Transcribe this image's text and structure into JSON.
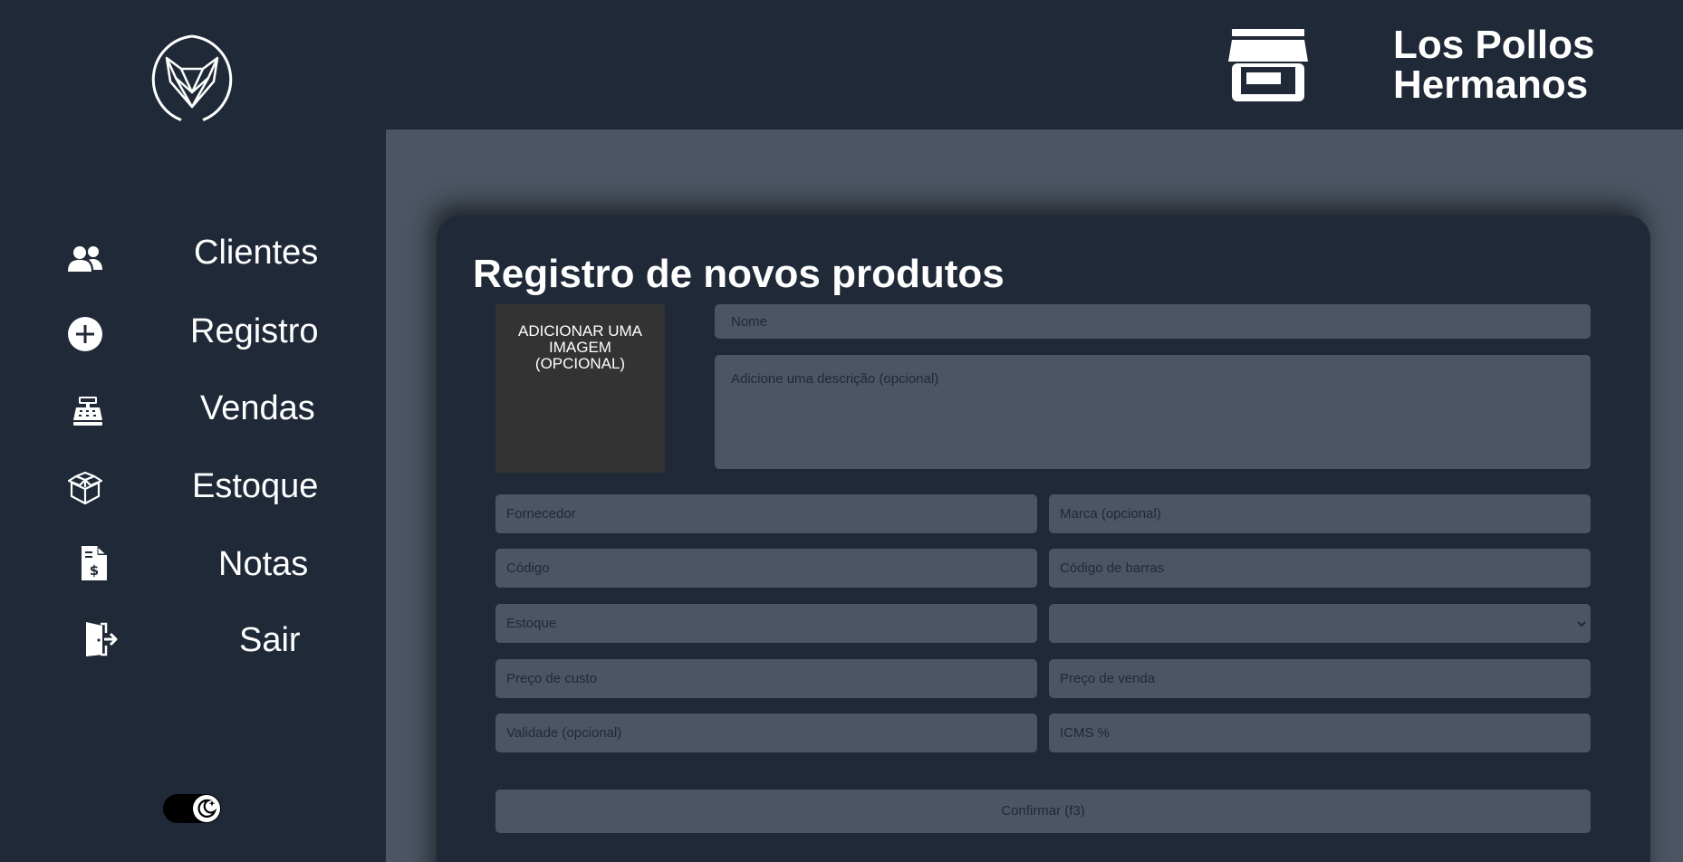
{
  "app": {
    "brand_name": "Los Pollos Hermanos"
  },
  "sidebar": {
    "logo_icon": "fox-logo-icon",
    "items": [
      {
        "label": "Clientes",
        "icon": "users-icon"
      },
      {
        "label": "Registro",
        "icon": "plus-circle-icon"
      },
      {
        "label": "Vendas",
        "icon": "cash-register-icon"
      },
      {
        "label": "Estoque",
        "icon": "boxes-icon"
      },
      {
        "label": "Notas",
        "icon": "invoice-dollar-icon"
      },
      {
        "label": "Sair",
        "icon": "door-exit-icon"
      }
    ],
    "theme_toggle_icon": "moon-icon"
  },
  "header": {
    "store_icon": "store-icon"
  },
  "form": {
    "title": "Registro de novos produtos",
    "image_upload_label": "ADICIONAR UMA IMAGEM (OPCIONAL)",
    "name_placeholder": "Nome",
    "description_placeholder": "Adicione uma descrição (opcional)",
    "supplier_placeholder": "Fornecedor",
    "brand_placeholder": "Marca (opcional)",
    "code_placeholder": "Código",
    "barcode_placeholder": "Código de barras",
    "stock_placeholder": "Estoque",
    "unit_select_value": "",
    "cost_price_placeholder": "Preço de custo",
    "sale_price_placeholder": "Preço de venda",
    "expiry_placeholder": "Validade (opcional)",
    "icms_placeholder": "ICMS %",
    "confirm_label": "Confirmar (f3)"
  },
  "colors": {
    "sidebar_bg": "#1f2937",
    "main_bg": "#4b5563",
    "card_bg": "#1f2937",
    "input_bg": "#4b5563",
    "image_box_bg": "#333333"
  }
}
